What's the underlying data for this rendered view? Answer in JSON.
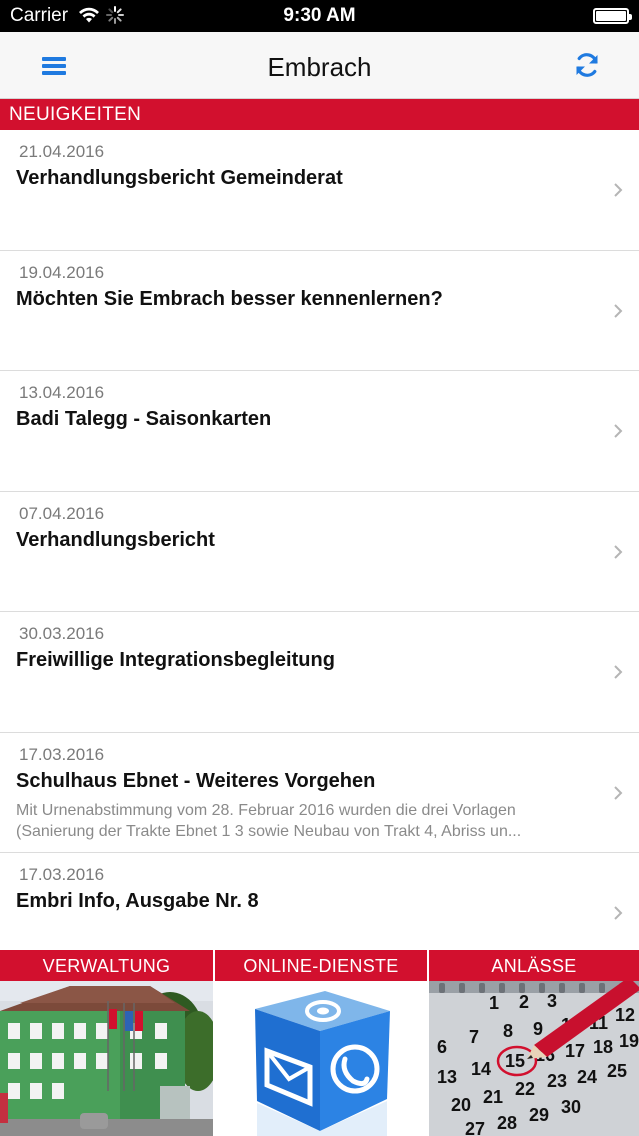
{
  "status_bar": {
    "carrier": "Carrier",
    "time": "9:30 AM"
  },
  "nav": {
    "title": "Embrach",
    "menu_icon": "hamburger-menu-icon",
    "refresh_icon": "refresh-icon",
    "accent_color": "#1f7ae0"
  },
  "section": {
    "title": "NEUIGKEITEN",
    "color": "#d2102e"
  },
  "news": [
    {
      "date": "21.04.2016",
      "title": "Verhandlungsbericht Gemeinderat"
    },
    {
      "date": "19.04.2016",
      "title": "Möchten Sie Embrach besser kennenlernen?"
    },
    {
      "date": "13.04.2016",
      "title": "Badi Talegg - Saisonkarten"
    },
    {
      "date": "07.04.2016",
      "title": "Verhandlungsbericht"
    },
    {
      "date": "30.03.2016",
      "title": "Freiwillige Integrationsbegleitung"
    },
    {
      "date": "17.03.2016",
      "title": "Schulhaus Ebnet - Weiteres Vorgehen",
      "excerpt_line1": "Mit Urnenabstimmung vom 28. Februar 2016 wurden die drei Vorlagen",
      "excerpt_line2": "(Sanierung der Trakte Ebnet 1  3 sowie Neubau von Trakt 4, Abriss un..."
    },
    {
      "date": "17.03.2016",
      "title": "Embri Info, Ausgabe Nr. 8"
    }
  ],
  "tiles": [
    {
      "label": "VERWALTUNG",
      "image": "town-hall-building-photo"
    },
    {
      "label": "ONLINE-DIENSTE",
      "image": "contact-cube-email-phone-icon"
    },
    {
      "label": "ANLÄSSE",
      "image": "calendar-with-red-pen-photo"
    }
  ],
  "calendar_numbers": [
    "1",
    "2",
    "3",
    "6",
    "7",
    "8",
    "9",
    "10",
    "11",
    "12",
    "13",
    "14",
    "15",
    "16",
    "17",
    "18",
    "19",
    "20",
    "21",
    "22",
    "23",
    "24",
    "25",
    "27",
    "28",
    "29",
    "30"
  ]
}
